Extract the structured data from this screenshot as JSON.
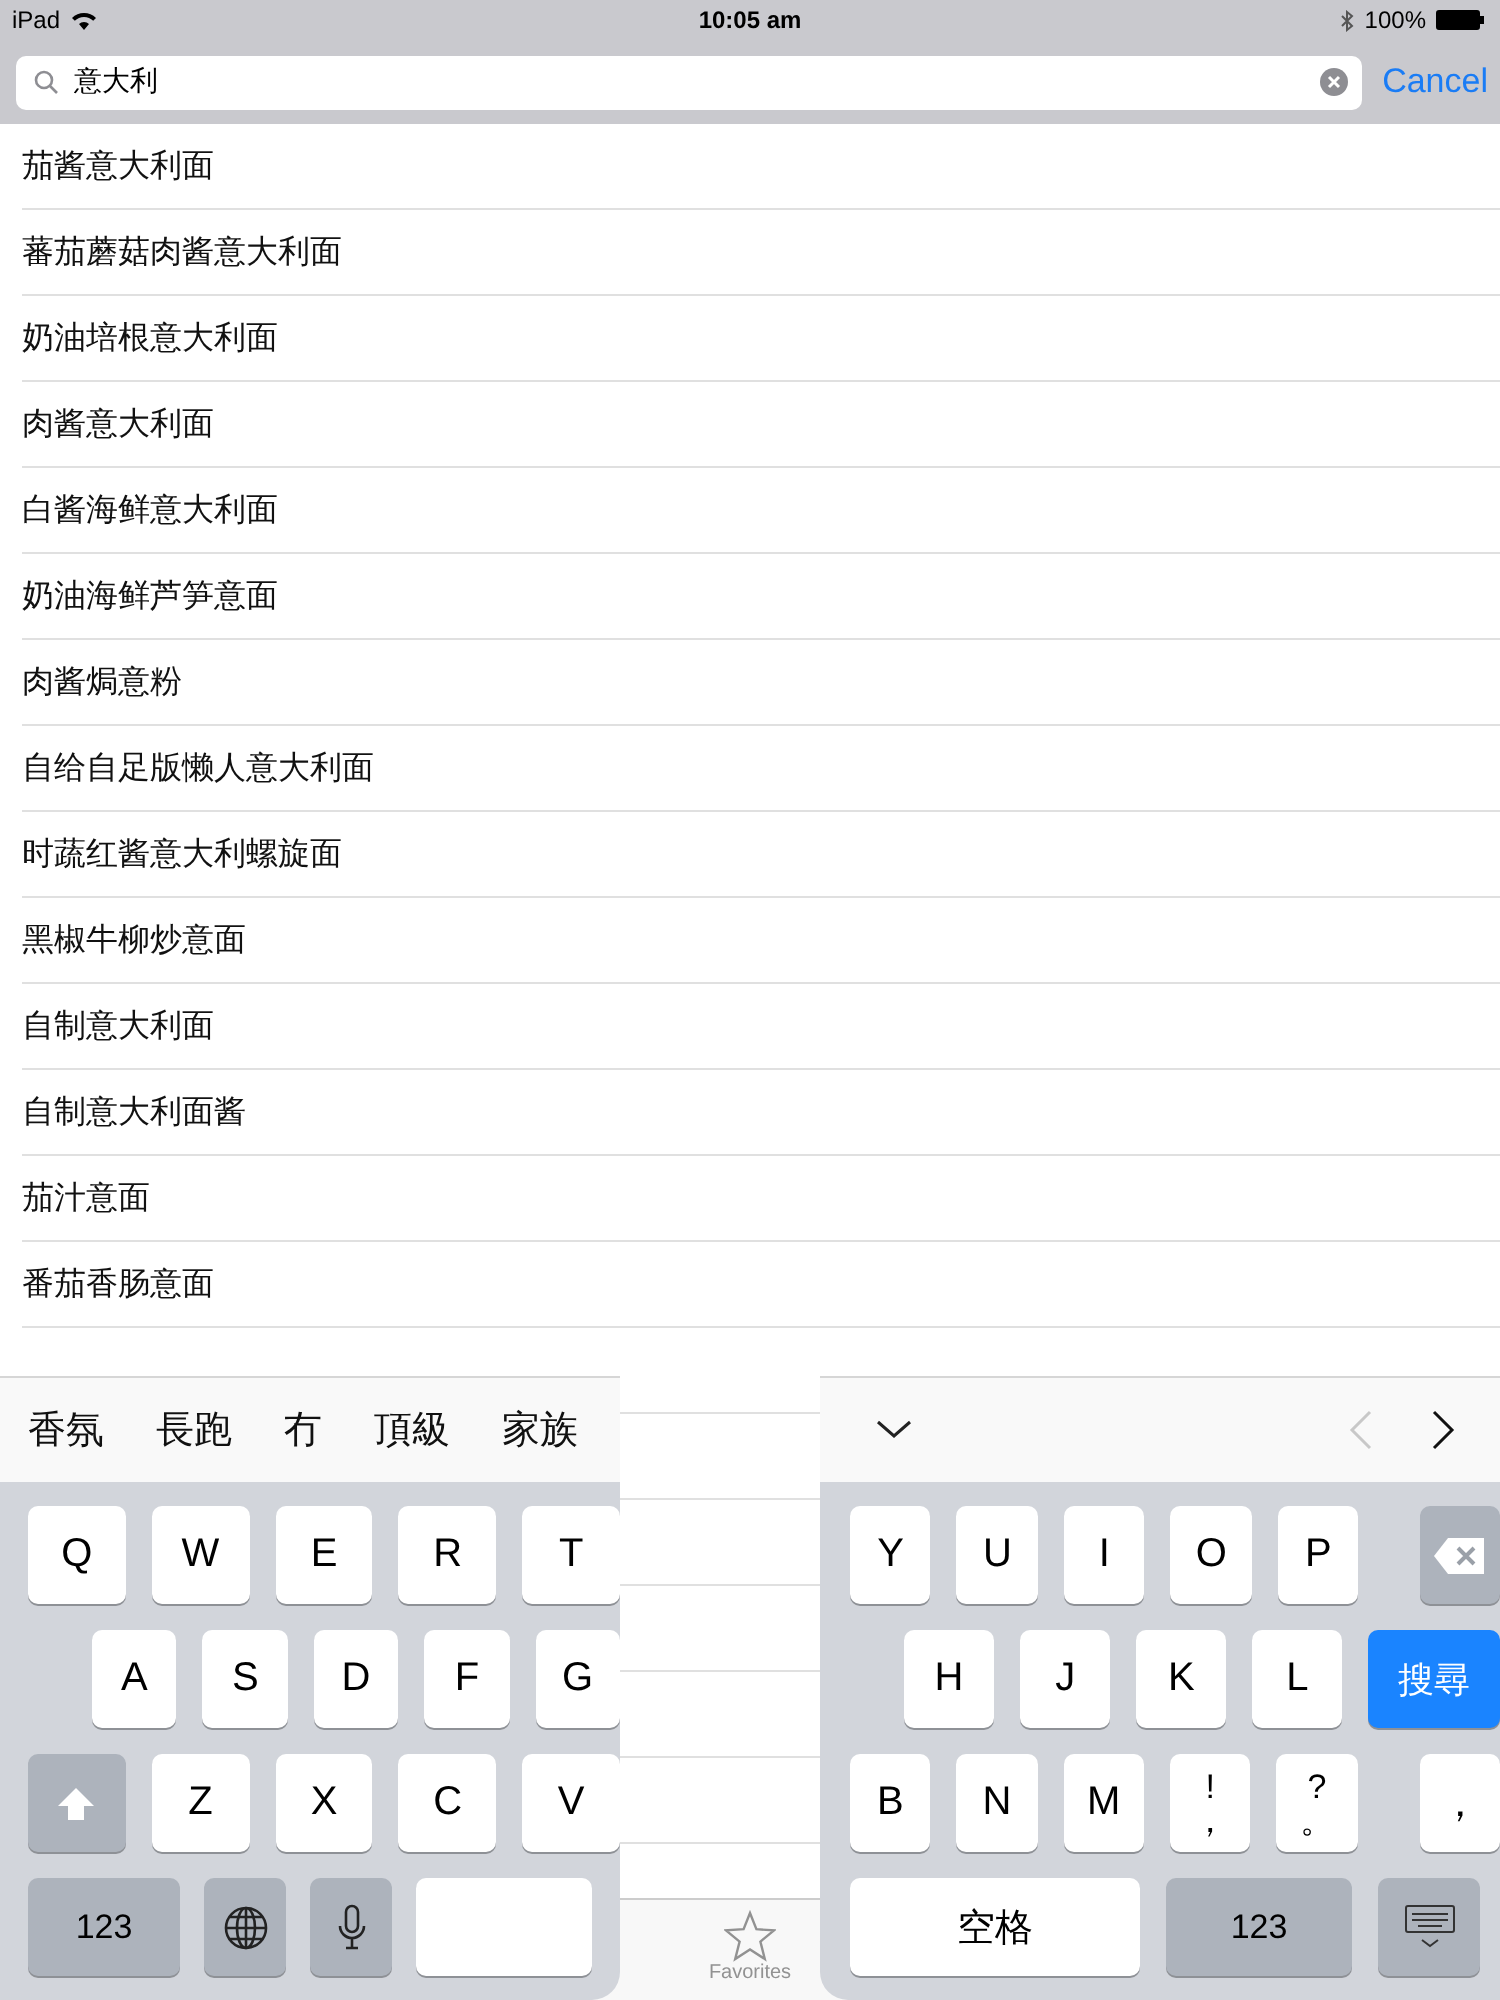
{
  "status_bar": {
    "device": "iPad",
    "time": "10:05 am",
    "battery": "100%"
  },
  "search": {
    "value": "意大利",
    "cancel": "Cancel"
  },
  "results": [
    "茄酱意大利面",
    "蕃茄蘑菇肉酱意大利面",
    "奶油培根意大利面",
    "肉酱意大利面",
    "白酱海鲜意大利面",
    "奶油海鲜芦笋意面",
    "肉酱焗意粉",
    "自给自足版懒人意大利面",
    "时蔬红酱意大利螺旋面",
    "黑椒牛柳炒意面",
    "自制意大利面",
    "自制意大利面酱",
    "茄汁意面",
    "番茄香肠意面"
  ],
  "tab_bar": {
    "items": [
      {
        "label": "Favorites",
        "selected": false
      }
    ]
  },
  "keyboard": {
    "candidates": [
      "香氛",
      "長跑",
      "冇",
      "頂級",
      "家族"
    ],
    "nav": {
      "prev_disabled": true,
      "next_disabled": false
    },
    "left_rows": [
      [
        {
          "kind": "letter",
          "label": "Q"
        },
        {
          "kind": "letter",
          "label": "W"
        },
        {
          "kind": "letter",
          "label": "E"
        },
        {
          "kind": "letter",
          "label": "R"
        },
        {
          "kind": "letter",
          "label": "T"
        }
      ],
      [
        {
          "kind": "letter",
          "label": "A"
        },
        {
          "kind": "letter",
          "label": "S"
        },
        {
          "kind": "letter",
          "label": "D"
        },
        {
          "kind": "letter",
          "label": "F"
        },
        {
          "kind": "letter",
          "label": "G"
        }
      ],
      [
        {
          "kind": "shift"
        },
        {
          "kind": "letter",
          "label": "Z"
        },
        {
          "kind": "letter",
          "label": "X"
        },
        {
          "kind": "letter",
          "label": "C"
        },
        {
          "kind": "letter",
          "label": "V"
        }
      ],
      [
        {
          "kind": "mode",
          "label": "123"
        },
        {
          "kind": "globe"
        },
        {
          "kind": "mic"
        },
        {
          "kind": "blank"
        }
      ]
    ],
    "right_rows": [
      [
        {
          "kind": "letter",
          "label": "Y"
        },
        {
          "kind": "letter",
          "label": "U"
        },
        {
          "kind": "letter",
          "label": "I"
        },
        {
          "kind": "letter",
          "label": "O"
        },
        {
          "kind": "letter",
          "label": "P"
        },
        {
          "kind": "backspace"
        }
      ],
      [
        {
          "kind": "letter",
          "label": "H"
        },
        {
          "kind": "letter",
          "label": "J"
        },
        {
          "kind": "letter",
          "label": "K"
        },
        {
          "kind": "letter",
          "label": "L"
        },
        {
          "kind": "action",
          "label": "搜尋"
        }
      ],
      [
        {
          "kind": "letter",
          "label": "B"
        },
        {
          "kind": "letter",
          "label": "N"
        },
        {
          "kind": "letter",
          "label": "M"
        },
        {
          "kind": "dual",
          "label": "!",
          "sub": "，"
        },
        {
          "kind": "dual",
          "label": "?",
          "sub": "。"
        },
        {
          "kind": "letter",
          "label": "，"
        }
      ],
      [
        {
          "kind": "space",
          "label": "空格"
        },
        {
          "kind": "mode",
          "label": "123"
        },
        {
          "kind": "hide"
        }
      ]
    ]
  }
}
